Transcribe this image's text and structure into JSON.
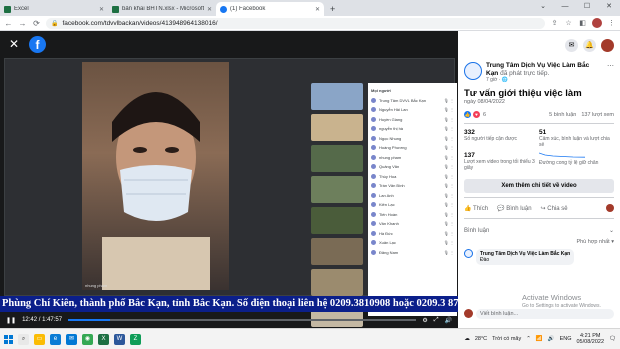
{
  "browser": {
    "tabs": [
      {
        "title": "Excel",
        "favicon_color": "#1d6f42",
        "active": false
      },
      {
        "title": "bản khai BHTN.xlsx - Microsoft E",
        "favicon_color": "#1d6f42",
        "active": false
      },
      {
        "title": "(1) Facebook",
        "favicon_color": "#1877f2",
        "active": true
      }
    ],
    "new_tab": "+",
    "url": "facebook.com/tdvvlbackan/videos/413948964138016/"
  },
  "viewer": {
    "close": "✕",
    "logo": "f",
    "camera_name": "nhung pham",
    "tiles": [
      "#8aa5c7",
      "#c9b38e",
      "#556a4a",
      "#6d7f5c",
      "#4a5c3a",
      "#7a6b55",
      "#9b8b6e",
      "#c4b8a3"
    ],
    "participants_title": "Mọi người",
    "participants": [
      "Trung Tâm DVVL Bắc Kạn",
      "Nguyễn Hải Lan",
      "Huyền Giang",
      "nguyễn thị hà",
      "Ngọc Nhung",
      "Hoàng Phương",
      "nhung pham",
      "Quảng Văn",
      "Thùy Hoa",
      "Trần Văn Bình",
      "Lan Anh",
      "Kiên Lạc",
      "Tiến Hoàn",
      "Vân Khanh",
      "Hà Đức",
      "Xuân Lạc",
      "Đăng Nam"
    ],
    "ticker": "Phùng Chí Kiên, thành phố Bắc Kạn, tỉnh Bắc Kạn. Số điện thoại liên hệ 0209.3810908 hoặc 0209.3 87",
    "time": "12:42 / 1:47:57",
    "progress": 0.12,
    "play_icon": "❚❚",
    "volume_icon": "🔊",
    "gear_icon": "⚙",
    "fullscreen_icon": "⤢"
  },
  "panel": {
    "page_name": "Trung Tâm Dịch Vụ Việc Làm Bắc Kạn",
    "page_suffix": "đã phát trực tiếp.",
    "posted": "7 giờ · ",
    "video_title": "Tư vấn giới thiệu việc làm",
    "video_date": "ngày 08/04/2022",
    "reaction_count": "6",
    "comments": "5 bình luận",
    "views": "137 lượt xem",
    "stats": [
      {
        "value": "332",
        "label": "Số người tiếp cận được"
      },
      {
        "value": "51",
        "label": "Cảm xúc, bình luận và lượt chia sẻ"
      },
      {
        "value": "137",
        "label": "Lượt xem video trong tối thiểu 3 giây"
      },
      {
        "value": "",
        "label": "Đường cong tỷ lệ giữ chân"
      }
    ],
    "more_btn": "Xem thêm chi tiết về video",
    "like": "Thích",
    "comment": "Bình luận",
    "share": "Chia sẻ",
    "comment_section": "Bình luận",
    "relevant": "Phù hợp nhất ▾",
    "first_comment_author": "Trung Tâm Dịch Vụ Việc Làm Bắc Kạn",
    "first_comment_text": "Đào",
    "write_placeholder": "Viết bình luận...",
    "watermark": "Activate Windows",
    "watermark_sub": "Go to Settings to activate Windows."
  },
  "taskbar": {
    "weather": "28°C",
    "weather_desc": "Trời có mây",
    "lang": "ENG",
    "time": "4:21 PM",
    "date": "05/08/2022"
  }
}
